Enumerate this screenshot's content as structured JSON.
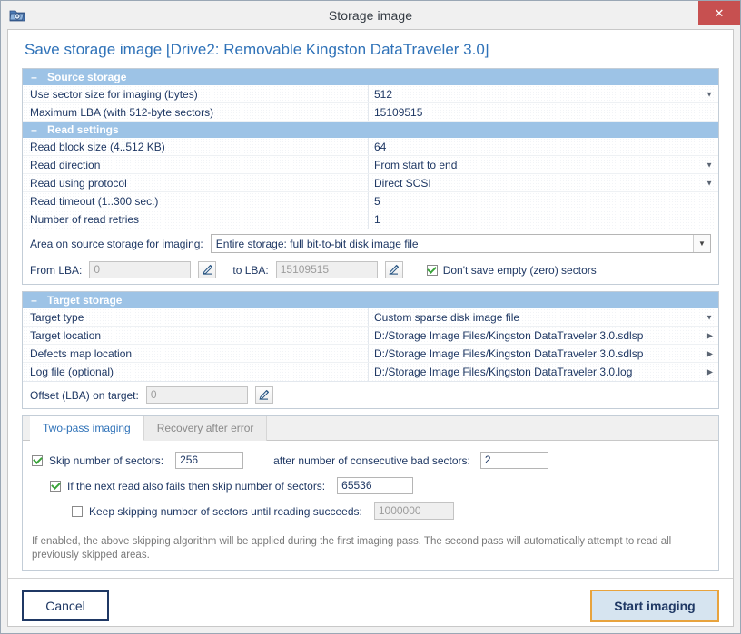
{
  "window": {
    "title": "Storage image",
    "app_icon": "folder-disk-icon",
    "close_label": "✕"
  },
  "page_title": "Save storage image [Drive2: Removable Kingston DataTraveler 3.0]",
  "groups": [
    {
      "name": "source-storage",
      "header": "Source storage",
      "collapse_glyph": "–",
      "rows": [
        {
          "label": "Use sector size for imaging (bytes)",
          "value": "512",
          "control": "dropdown"
        },
        {
          "label": "Maximum LBA (with 512-byte sectors)",
          "value": "15109515",
          "control": "text"
        }
      ]
    },
    {
      "name": "read-settings",
      "header": "Read settings",
      "collapse_glyph": "–",
      "rows": [
        {
          "label": "Read block size (4..512 KB)",
          "value": "64",
          "control": "text"
        },
        {
          "label": "Read direction",
          "value": "From start to end",
          "control": "dropdown"
        },
        {
          "label": "Read using protocol",
          "value": "Direct SCSI",
          "control": "dropdown"
        },
        {
          "label": "Read timeout (1..300 sec.)",
          "value": "5",
          "control": "text"
        },
        {
          "label": "Number of read retries",
          "value": "1",
          "control": "text"
        }
      ]
    }
  ],
  "area_section": {
    "area_label": "Area on source storage for imaging:",
    "area_value": "Entire storage: full bit-to-bit disk image file",
    "from_lba_label": "From LBA:",
    "from_lba_value": "0",
    "to_lba_label": "to LBA:",
    "to_lba_value": "15109515",
    "dont_save_empty_label": "Don't save empty (zero) sectors",
    "dont_save_empty_checked": true
  },
  "target_group": {
    "header": "Target storage",
    "collapse_glyph": "–",
    "rows": [
      {
        "label": "Target type",
        "value": "Custom sparse disk image file",
        "control": "dropdown"
      },
      {
        "label": "Target location",
        "value": "D:/Storage Image Files/Kingston DataTraveler 3.0.sdlsp",
        "control": "browse"
      },
      {
        "label": "Defects map location",
        "value": "D:/Storage Image Files/Kingston DataTraveler 3.0.sdlsp",
        "control": "browse"
      },
      {
        "label": "Log file (optional)",
        "value": "D:/Storage Image Files/Kingston DataTraveler 3.0.log",
        "control": "browse"
      }
    ],
    "offset_label": "Offset (LBA) on target:",
    "offset_value": "0"
  },
  "tabs": [
    {
      "label": "Two-pass imaging",
      "active": true
    },
    {
      "label": "Recovery after error",
      "active": false
    }
  ],
  "two_pass": {
    "skip_checked": true,
    "skip_label": "Skip number of sectors:",
    "skip_value": "256",
    "after_label": "after number of consecutive bad sectors:",
    "after_value": "2",
    "next_read_checked": true,
    "next_read_label": "If the next read also fails then skip number of sectors:",
    "next_read_value": "65536",
    "keep_checked": false,
    "keep_label": "Keep skipping number of sectors until reading succeeds:",
    "keep_value": "1000000",
    "help": "If enabled, the above skipping algorithm will be applied during the first imaging pass. The second pass will automatically attempt to read all previously skipped areas."
  },
  "footer": {
    "cancel_label": "Cancel",
    "start_label": "Start imaging"
  },
  "glyphs": {
    "down_arrow": "▼",
    "right_arrow": "▶"
  },
  "colors": {
    "group_header_bg": "#9dc3e6",
    "title_blue": "#2f72b8",
    "text_navy": "#1f3864",
    "close_red": "#c75050",
    "primary_border": "#e8a33d",
    "primary_bg": "#d6e4f0"
  }
}
